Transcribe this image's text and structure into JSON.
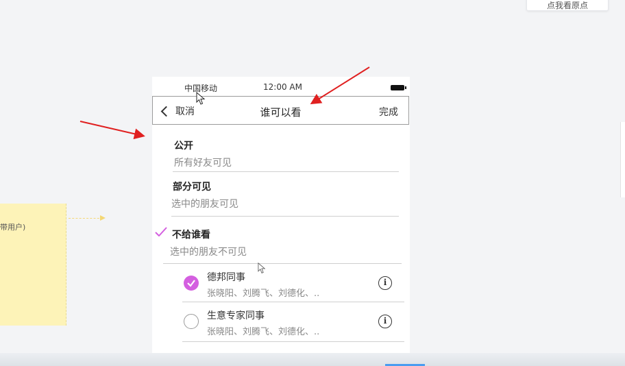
{
  "canvas": {
    "top_button_label": "点我看原点",
    "sticky_note_text": "带用户)"
  },
  "status_bar": {
    "carrier": "中国移动",
    "time": "12:00 AM"
  },
  "nav": {
    "back_label": "取消",
    "title": "谁可以看",
    "done_label": "完成"
  },
  "options": [
    {
      "title": "公开",
      "subtitle": "所有好友可见",
      "selected": false
    },
    {
      "title": "部分可见",
      "subtitle": "选中的朋友可见",
      "selected": false
    },
    {
      "title": "不给谁看",
      "subtitle": "选中的朋友不可见",
      "selected": true
    }
  ],
  "groups": [
    {
      "name": "德邦同事",
      "members": "张晓阳、刘腾飞、刘德化、..",
      "checked": true
    },
    {
      "name": "生意专家同事",
      "members": "张晓阳、刘腾飞、刘德化、..",
      "checked": false
    }
  ],
  "colors": {
    "accent": "#d45fe0",
    "annotation_arrow": "#e02020",
    "sticky_note": "#fdf3b8"
  },
  "icons": [
    "back-chevron-icon",
    "battery-icon",
    "checkmark-icon",
    "info-icon",
    "mouse-cursor-icon"
  ]
}
